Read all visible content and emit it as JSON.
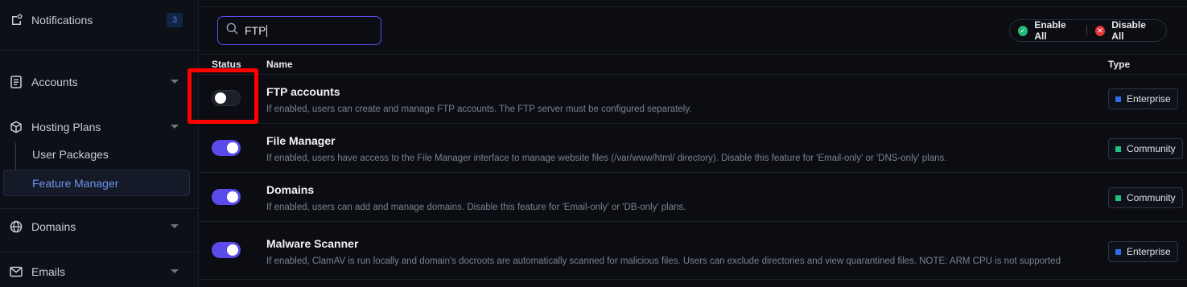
{
  "sidebar": {
    "notifications": {
      "label": "Notifications",
      "count": "3"
    },
    "items": [
      {
        "label": "Accounts"
      },
      {
        "label": "Hosting Plans"
      },
      {
        "label": "Domains"
      },
      {
        "label": "Emails"
      }
    ],
    "subitems": [
      {
        "label": "User Packages"
      },
      {
        "label": "Feature Manager",
        "active": true
      }
    ]
  },
  "search": {
    "value": "FTP",
    "placeholder": "Search"
  },
  "bulk": {
    "enable_all": "Enable All",
    "disable_all": "Disable All"
  },
  "table": {
    "headers": {
      "status": "Status",
      "name": "Name",
      "type": "Type"
    },
    "rows": [
      {
        "name": "FTP accounts",
        "description": "If enabled, users can create and manage FTP accounts. The FTP server must be configured separately.",
        "enabled": false,
        "type": "Enterprise"
      },
      {
        "name": "File Manager",
        "description": "If enabled, users have access to the File Manager interface to manage website files (/var/www/html/ directory). Disable this feature for 'Email-only' or 'DNS-only' plans.",
        "enabled": true,
        "type": "Community"
      },
      {
        "name": "Domains",
        "description": "If enabled, users can add and manage domains. Disable this feature for 'Email-only' or 'DB-only' plans.",
        "enabled": true,
        "type": "Community"
      },
      {
        "name": "Malware Scanner",
        "description": "If enabled, ClamAV is run locally and domain's docroots are automatically scanned for malicious files. Users can exclude directories and view quarantined files. NOTE: ARM CPU is not supported",
        "enabled": true,
        "type": "Enterprise"
      }
    ]
  },
  "colors": {
    "accent": "#5a4bea",
    "enterprise": "#2f6df0",
    "community": "#22c380",
    "enable_icon": "#22b573",
    "disable_icon": "#e5383b",
    "highlight": "#ff0000"
  }
}
